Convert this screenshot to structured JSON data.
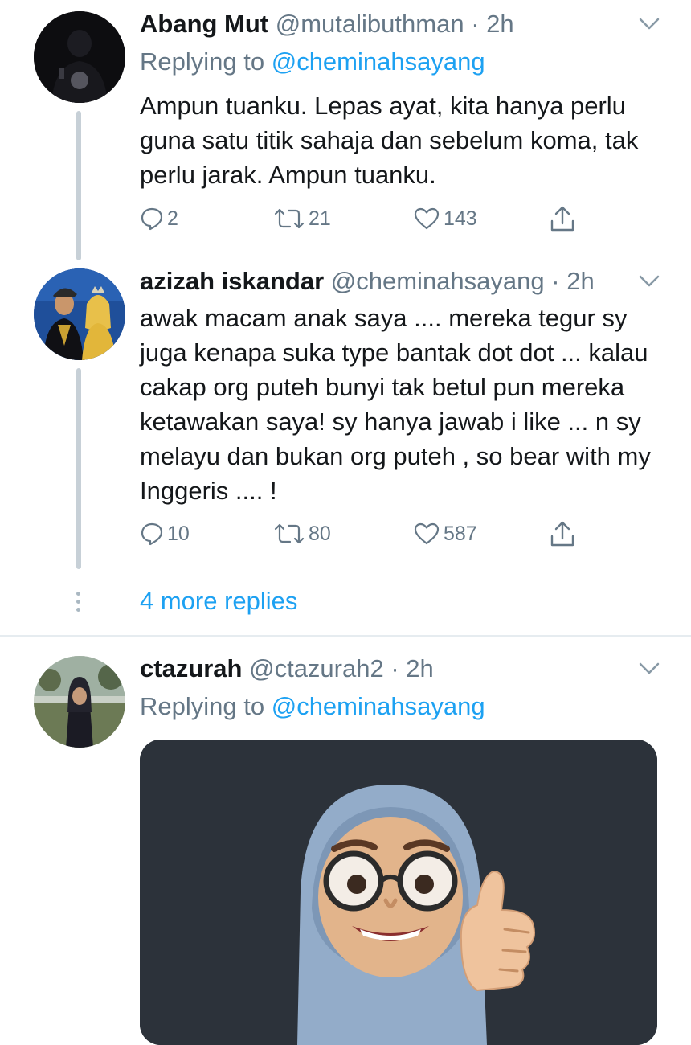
{
  "tweets": [
    {
      "name": "Abang Mut",
      "handle": "@mutalibuthman",
      "time": "· 2h",
      "replying_label": "Replying to",
      "replying_handle": "@cheminahsayang",
      "text": "Ampun tuanku. Lepas ayat, kita hanya perlu guna satu titik sahaja dan sebelum koma, tak perlu jarak. Ampun tuanku.",
      "replies": "2",
      "retweets": "21",
      "likes": "143"
    },
    {
      "name": "azizah iskandar",
      "handle": "@cheminahsayang",
      "time": "· 2h",
      "text": "awak macam anak saya .... mereka tegur sy juga kenapa suka type bantak dot dot ... kalau cakap org puteh bunyi tak betul pun mereka ketawakan saya! sy hanya jawab i like ... n sy melayu dan bukan org puteh , so bear with my Inggeris .... !",
      "replies": "10",
      "retweets": "80",
      "likes": "587"
    },
    {
      "name": "ctazurah",
      "handle": "@ctazurah2",
      "time": "· 2h",
      "replying_label": "Replying to",
      "replying_handle": "@cheminahsayang"
    }
  ],
  "more_replies": "4 more replies",
  "icons": [
    "chevron-down-icon",
    "reply-icon",
    "retweet-icon",
    "like-icon",
    "share-icon"
  ],
  "colors": {
    "link": "#1da1f2",
    "muted": "#657786",
    "thread_line": "#c7d0d7",
    "media_bg": "#2c323a"
  }
}
